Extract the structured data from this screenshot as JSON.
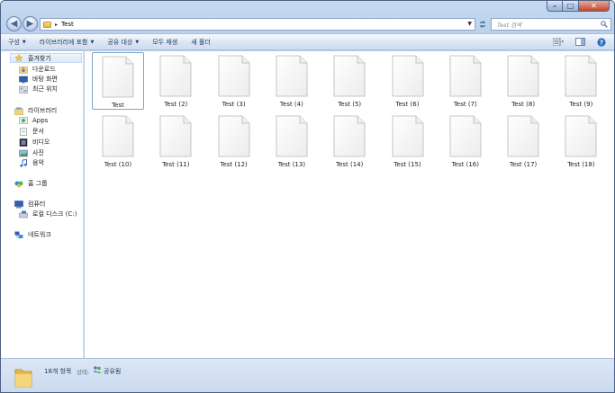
{
  "window": {
    "caption": {
      "minimize": "–",
      "maximize": "□",
      "close": "✕"
    }
  },
  "address": {
    "separator": "▸",
    "path": "Test",
    "search_placeholder": "Test 검색"
  },
  "toolbar": {
    "items": [
      {
        "label": "구성",
        "dropdown": true
      },
      {
        "label": "라이브러리에 포함",
        "dropdown": true
      },
      {
        "label": "공유 대상",
        "dropdown": true
      },
      {
        "label": "모두 재생",
        "dropdown": false
      },
      {
        "label": "새 폴더",
        "dropdown": false
      }
    ],
    "dropdown_glyph": "▼"
  },
  "sidebar": {
    "favorites": {
      "label": "즐겨찾기",
      "items": [
        "다운로드",
        "바탕 화면",
        "최근 위치"
      ]
    },
    "libraries": {
      "label": "라이브러리",
      "items": [
        "Apps",
        "문서",
        "비디오",
        "사진",
        "음악"
      ]
    },
    "homegroup": {
      "label": "홈 그룹"
    },
    "computer": {
      "label": "컴퓨터",
      "items": [
        "로컬 디스크 (C:)"
      ]
    },
    "network": {
      "label": "네트워크"
    }
  },
  "files": [
    "Test",
    "Test (2)",
    "Test (3)",
    "Test (4)",
    "Test (5)",
    "Test (6)",
    "Test (7)",
    "Test (8)",
    "Test (9)",
    "Test (10)",
    "Test (11)",
    "Test (12)",
    "Test (13)",
    "Test (14)",
    "Test (15)",
    "Test (16)",
    "Test (17)",
    "Test (18)"
  ],
  "status": {
    "count": "18개 항목",
    "state_label": "상태:",
    "state_value": "공유됨"
  },
  "colors": {
    "accent": "#1e395b",
    "selection_border": "#7da2ce"
  }
}
